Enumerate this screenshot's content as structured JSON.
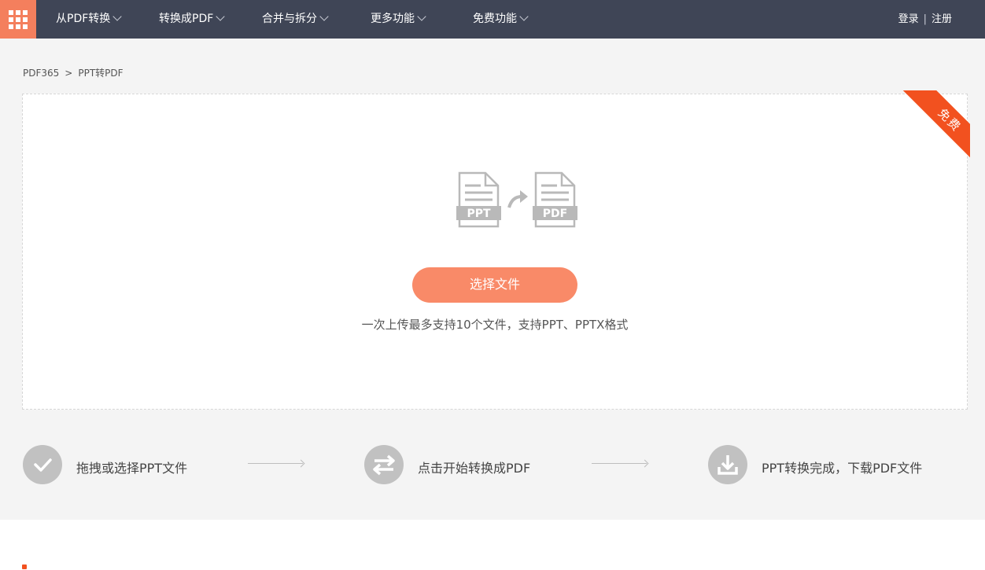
{
  "nav": {
    "apps_icon": "grid-icon",
    "items": [
      {
        "label": "从PDF转换"
      },
      {
        "label": "转换成PDF"
      },
      {
        "label": "合并与拆分"
      },
      {
        "label": "更多功能"
      },
      {
        "label": "免费功能"
      }
    ],
    "login": "登录",
    "separator": "|",
    "register": "注册"
  },
  "breadcrumb": {
    "home": "PDF365",
    "separator": ">",
    "current": "PPT转PDF"
  },
  "upload": {
    "badge": "免费",
    "source_format": "PPT",
    "target_format": "PDF",
    "button_label": "选择文件",
    "hint": "一次上传最多支持10个文件，支持PPT、PPTX格式"
  },
  "steps": [
    {
      "icon": "check-icon",
      "label": "拖拽或选择PPT文件"
    },
    {
      "icon": "swap-arrows-icon",
      "label": "点击开始转换成PDF"
    },
    {
      "icon": "download-icon",
      "label": "PPT转换完成，下载PDF文件"
    }
  ],
  "colors": {
    "topbar": "#3f4556",
    "accent": "#f47f5d",
    "button": "#f98a68",
    "ribbon": "#f2511f",
    "step_icon": "#c1c1c1"
  }
}
